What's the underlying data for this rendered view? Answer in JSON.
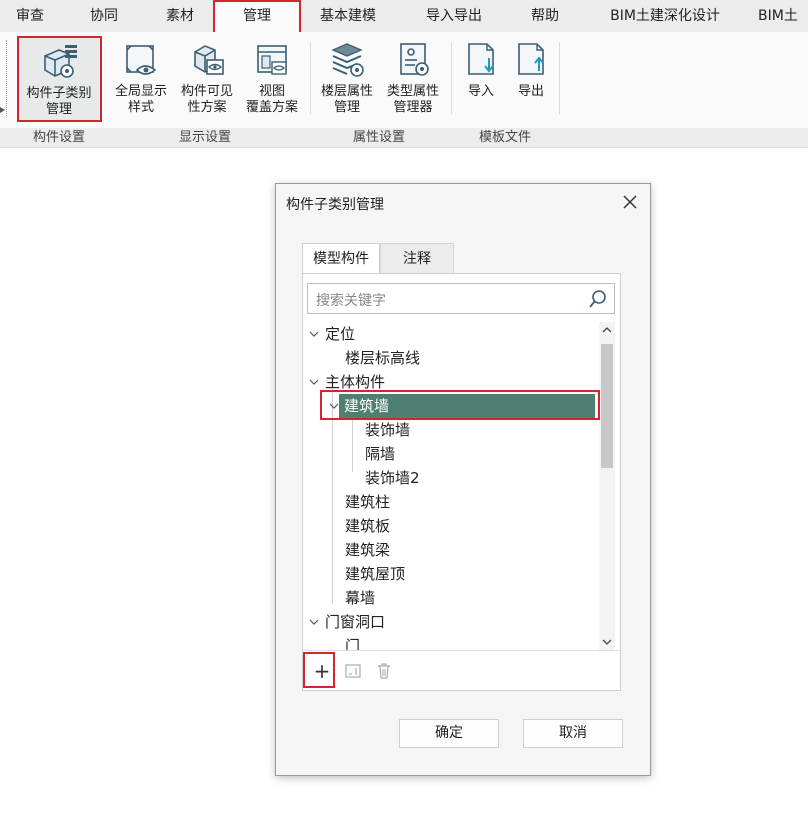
{
  "menu": {
    "items": [
      {
        "label": "审查"
      },
      {
        "label": "协同"
      },
      {
        "label": "素材"
      },
      {
        "label": "管理"
      },
      {
        "label": "基本建模"
      },
      {
        "label": "导入导出"
      },
      {
        "label": "帮助"
      },
      {
        "label": "BIM土建深化设计"
      },
      {
        "label": "BIM土"
      }
    ],
    "active": "管理"
  },
  "ribbon": {
    "buttons": [
      {
        "line1": "构件子类别",
        "line2": "管理",
        "icon": "component-subcategory-gear-icon"
      },
      {
        "line1": "全局显示",
        "line2": "样式",
        "icon": "global-display-eye-icon"
      },
      {
        "line1": "构件可见",
        "line2": "性方案",
        "icon": "component-visibility-icon"
      },
      {
        "line1": "视图",
        "line2": "覆盖方案",
        "icon": "view-override-icon"
      },
      {
        "line1": "楼层属性",
        "line2": "管理",
        "icon": "floor-stack-gear-icon"
      },
      {
        "line1": "类型属性",
        "line2": "管理器",
        "icon": "type-property-gear-icon"
      },
      {
        "line1": "导入",
        "line2": "",
        "icon": "import-file-icon"
      },
      {
        "line1": "导出",
        "line2": "",
        "icon": "export-file-icon"
      }
    ],
    "groups": [
      {
        "label": "构件设置"
      },
      {
        "label": "显示设置"
      },
      {
        "label": "属性设置"
      },
      {
        "label": "模板文件"
      }
    ]
  },
  "dialog": {
    "title": "构件子类别管理",
    "tabs": [
      {
        "label": "模型构件"
      },
      {
        "label": "注释"
      }
    ],
    "search": {
      "placeholder": "搜索关键字"
    },
    "tree": [
      {
        "label": "定位",
        "level": 0,
        "expanded": true
      },
      {
        "label": "楼层标高线",
        "level": 1
      },
      {
        "label": "主体构件",
        "level": 0,
        "expanded": true
      },
      {
        "label": "建筑墙",
        "level": 1,
        "expanded": true,
        "selected": true
      },
      {
        "label": "装饰墙",
        "level": 2
      },
      {
        "label": "隔墙",
        "level": 2
      },
      {
        "label": "装饰墙2",
        "level": 2
      },
      {
        "label": "建筑柱",
        "level": 1
      },
      {
        "label": "建筑板",
        "level": 1
      },
      {
        "label": "建筑梁",
        "level": 1
      },
      {
        "label": "建筑屋顶",
        "level": 1
      },
      {
        "label": "幕墙",
        "level": 1
      },
      {
        "label": "门窗洞口",
        "level": 0,
        "expanded": true
      },
      {
        "label": "门",
        "level": 1
      }
    ],
    "tools": {
      "add": "+"
    },
    "ok_label": "确定",
    "cancel_label": "取消"
  },
  "colors": {
    "highlight_box": "#d4242e",
    "selected_row": "#4d8070"
  }
}
